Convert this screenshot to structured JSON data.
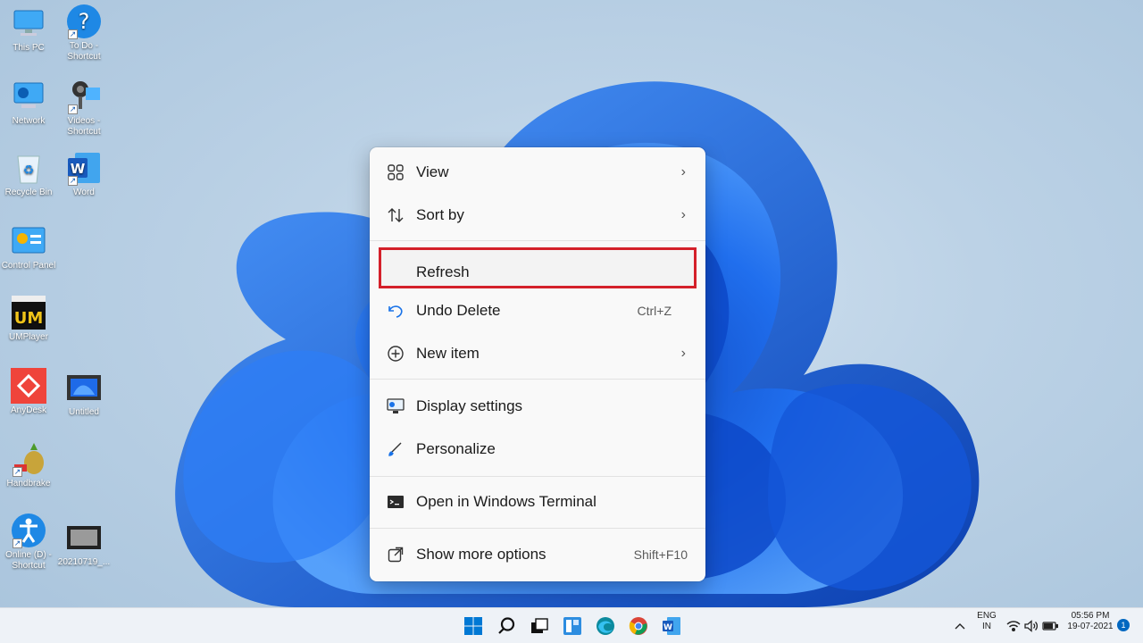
{
  "desktop": {
    "icons": [
      {
        "label": "This PC",
        "icon": "monitor-icon"
      },
      {
        "label": "To Do - Shortcut",
        "icon": "question-icon"
      },
      {
        "label": "Network",
        "icon": "network-icon"
      },
      {
        "label": "Videos - Shortcut",
        "icon": "webcam-icon"
      },
      {
        "label": "Recycle Bin",
        "icon": "recycle-bin-icon"
      },
      {
        "label": "Word",
        "icon": "word-icon"
      },
      {
        "label": "Control Panel",
        "icon": "control-panel-icon"
      },
      {
        "label": "UMPlayer",
        "icon": "umplayer-icon"
      },
      {
        "label": "AnyDesk",
        "icon": "anydesk-icon"
      },
      {
        "label": "Untitled",
        "icon": "video-file-icon"
      },
      {
        "label": "Handbrake",
        "icon": "handbrake-icon"
      },
      {
        "label": "Online (D) - Shortcut",
        "icon": "accessibility-icon"
      },
      {
        "label": "20210719_...",
        "icon": "image-file-icon"
      }
    ]
  },
  "context_menu": {
    "items": [
      {
        "label": "View",
        "icon": "grid-icon",
        "has_submenu": true
      },
      {
        "label": "Sort by",
        "icon": "sort-icon",
        "has_submenu": true
      },
      {
        "label": "Refresh",
        "icon": "",
        "highlighted": true
      },
      {
        "label": "Undo Delete",
        "icon": "undo-icon",
        "shortcut": "Ctrl+Z"
      },
      {
        "label": "New item",
        "icon": "plus-circle-icon",
        "has_submenu": true
      },
      {
        "label": "Display settings",
        "icon": "display-icon"
      },
      {
        "label": "Personalize",
        "icon": "brush-icon"
      },
      {
        "label": "Open in Windows Terminal",
        "icon": "terminal-icon"
      },
      {
        "label": "Show more options",
        "icon": "external-icon",
        "shortcut": "Shift+F10"
      }
    ],
    "highlight_color": "#d4202a"
  },
  "taskbar": {
    "apps": [
      "start-icon",
      "search-icon",
      "task-view-icon",
      "widgets-icon",
      "edge-icon",
      "chrome-icon",
      "word-icon"
    ],
    "tray": {
      "language": "ENG",
      "region": "IN",
      "time": "05:56 PM",
      "date": "19-07-2021",
      "notification_count": "1"
    }
  },
  "colors": {
    "accent": "#0067c0",
    "bloom": "#1e6ae8"
  }
}
